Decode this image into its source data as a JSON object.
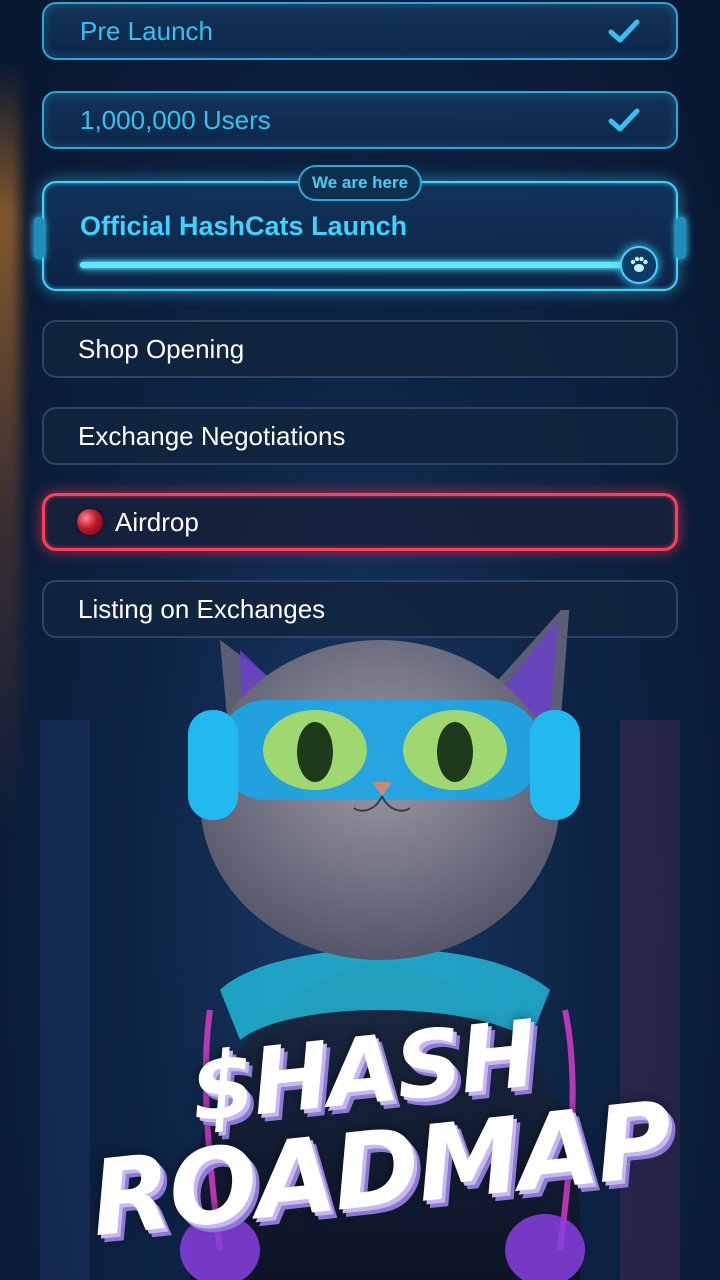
{
  "milestones": {
    "pre_launch": "Pre Launch",
    "users": "1,000,000 Users",
    "current_badge": "We are here",
    "current_label": "Official HashCats Launch",
    "current_progress_pct": 100,
    "shop": "Shop Opening",
    "exchange_negotiations": "Exchange Negotiations",
    "airdrop": "Airdrop",
    "listing": "Listing on Exchanges"
  },
  "hero": {
    "line1": "$HASH",
    "line2": "ROADMAP"
  },
  "icons": {
    "completed": "check-icon",
    "progress_marker": "paw-icon",
    "airdrop": "gem-icon"
  },
  "colors": {
    "completed": "#38c0f0",
    "current": "#3fd2ff",
    "airdrop_border": "#ff3d5a"
  }
}
